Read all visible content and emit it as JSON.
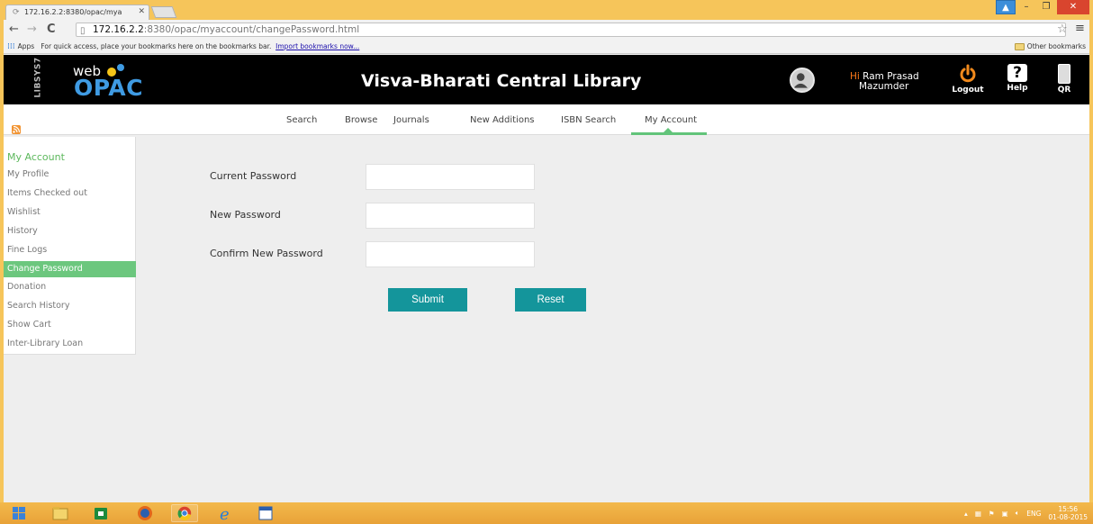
{
  "browser": {
    "tab_title": "172.16.2.2:8380/opac/mya",
    "address": {
      "host": "172.16.2.2",
      "path": ":8380/opac/myaccount/changePassword.html"
    },
    "bookmarks_bar": {
      "apps_label": "Apps",
      "hint_text": "For quick access, place your bookmarks here on the bookmarks bar.",
      "import_link": "Import bookmarks now...",
      "other_label": "Other bookmarks"
    }
  },
  "header": {
    "side_logo": "LIBSYS7",
    "logo_web": "web",
    "logo_opac": "OPAC",
    "title": "Visva-Bharati Central Library",
    "greeting_hi": "Hi",
    "user_first": "Ram Prasad",
    "user_last": "Mazumder",
    "logout_label": "Logout",
    "help_label": "Help",
    "qr_label": "QR"
  },
  "nav": {
    "items": [
      {
        "label": "Search"
      },
      {
        "label": "Browse"
      },
      {
        "label": "Journals"
      },
      {
        "label": "New Additions"
      },
      {
        "label": "ISBN Search"
      },
      {
        "label": "My Account"
      }
    ],
    "active": "My Account"
  },
  "sidebar": {
    "title": "My Account",
    "items": [
      {
        "label": "My Profile"
      },
      {
        "label": "Items Checked out"
      },
      {
        "label": "Wishlist"
      },
      {
        "label": "History"
      },
      {
        "label": "Fine Logs"
      },
      {
        "label": "Change Password"
      },
      {
        "label": "Donation"
      },
      {
        "label": "Search History"
      },
      {
        "label": "Show Cart"
      },
      {
        "label": "Inter-Library Loan"
      }
    ],
    "active": "Change Password"
  },
  "form": {
    "current_password_label": "Current Password",
    "current_password_value": "",
    "new_password_label": "New Password",
    "new_password_value": "",
    "confirm_password_label": "Confirm New Password",
    "confirm_password_value": "",
    "submit_label": "Submit",
    "reset_label": "Reset"
  },
  "taskbar": {
    "language": "ENG",
    "time": "15:56",
    "date": "01-08-2015"
  },
  "colors": {
    "accent_green": "#62c47a",
    "button_teal": "#14959b",
    "logo_blue": "#3f9be3",
    "taskbar_orange": "#f3b94c"
  }
}
